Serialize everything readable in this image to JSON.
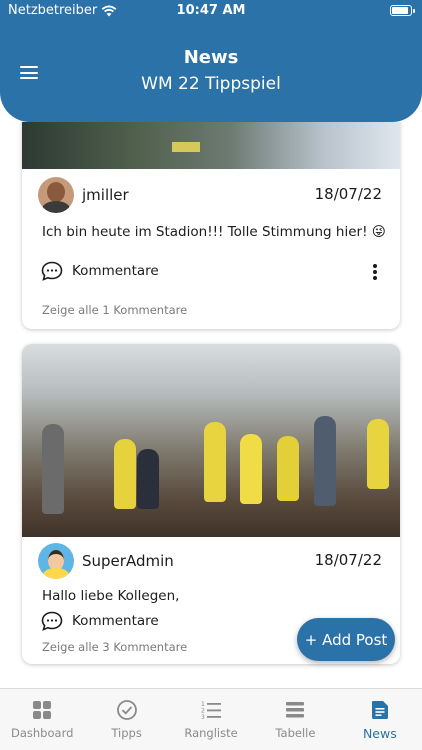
{
  "status_bar": {
    "carrier": "Netzbetreiber",
    "time": "10:47 AM"
  },
  "header": {
    "title": "News",
    "subtitle": "WM 22 Tippspiel"
  },
  "posts": [
    {
      "username": "jmiller",
      "date": "18/07/22",
      "text": "Ich bin heute im Stadion!!! Tolle Stimmung hier! 😜",
      "comments_label": "Kommentare",
      "show_all": "Zeige alle 1 Kommentare"
    },
    {
      "username": "SuperAdmin",
      "date": "18/07/22",
      "text": "Hallo liebe Kollegen,",
      "comments_label": "Kommentare",
      "show_all": "Zeige alle 3 Kommentare"
    }
  ],
  "fab": {
    "label": "+ Add Post"
  },
  "tabbar": {
    "items": [
      {
        "label": "Dashboard",
        "icon": "grid-icon"
      },
      {
        "label": "Tipps",
        "icon": "check-circle-icon"
      },
      {
        "label": "Rangliste",
        "icon": "ranked-list-icon"
      },
      {
        "label": "Tabelle",
        "icon": "table-icon"
      },
      {
        "label": "News",
        "icon": "news-icon"
      }
    ],
    "active": "News"
  },
  "colors": {
    "primary": "#2b72a8",
    "tab_inactive": "#8a8a8a"
  }
}
